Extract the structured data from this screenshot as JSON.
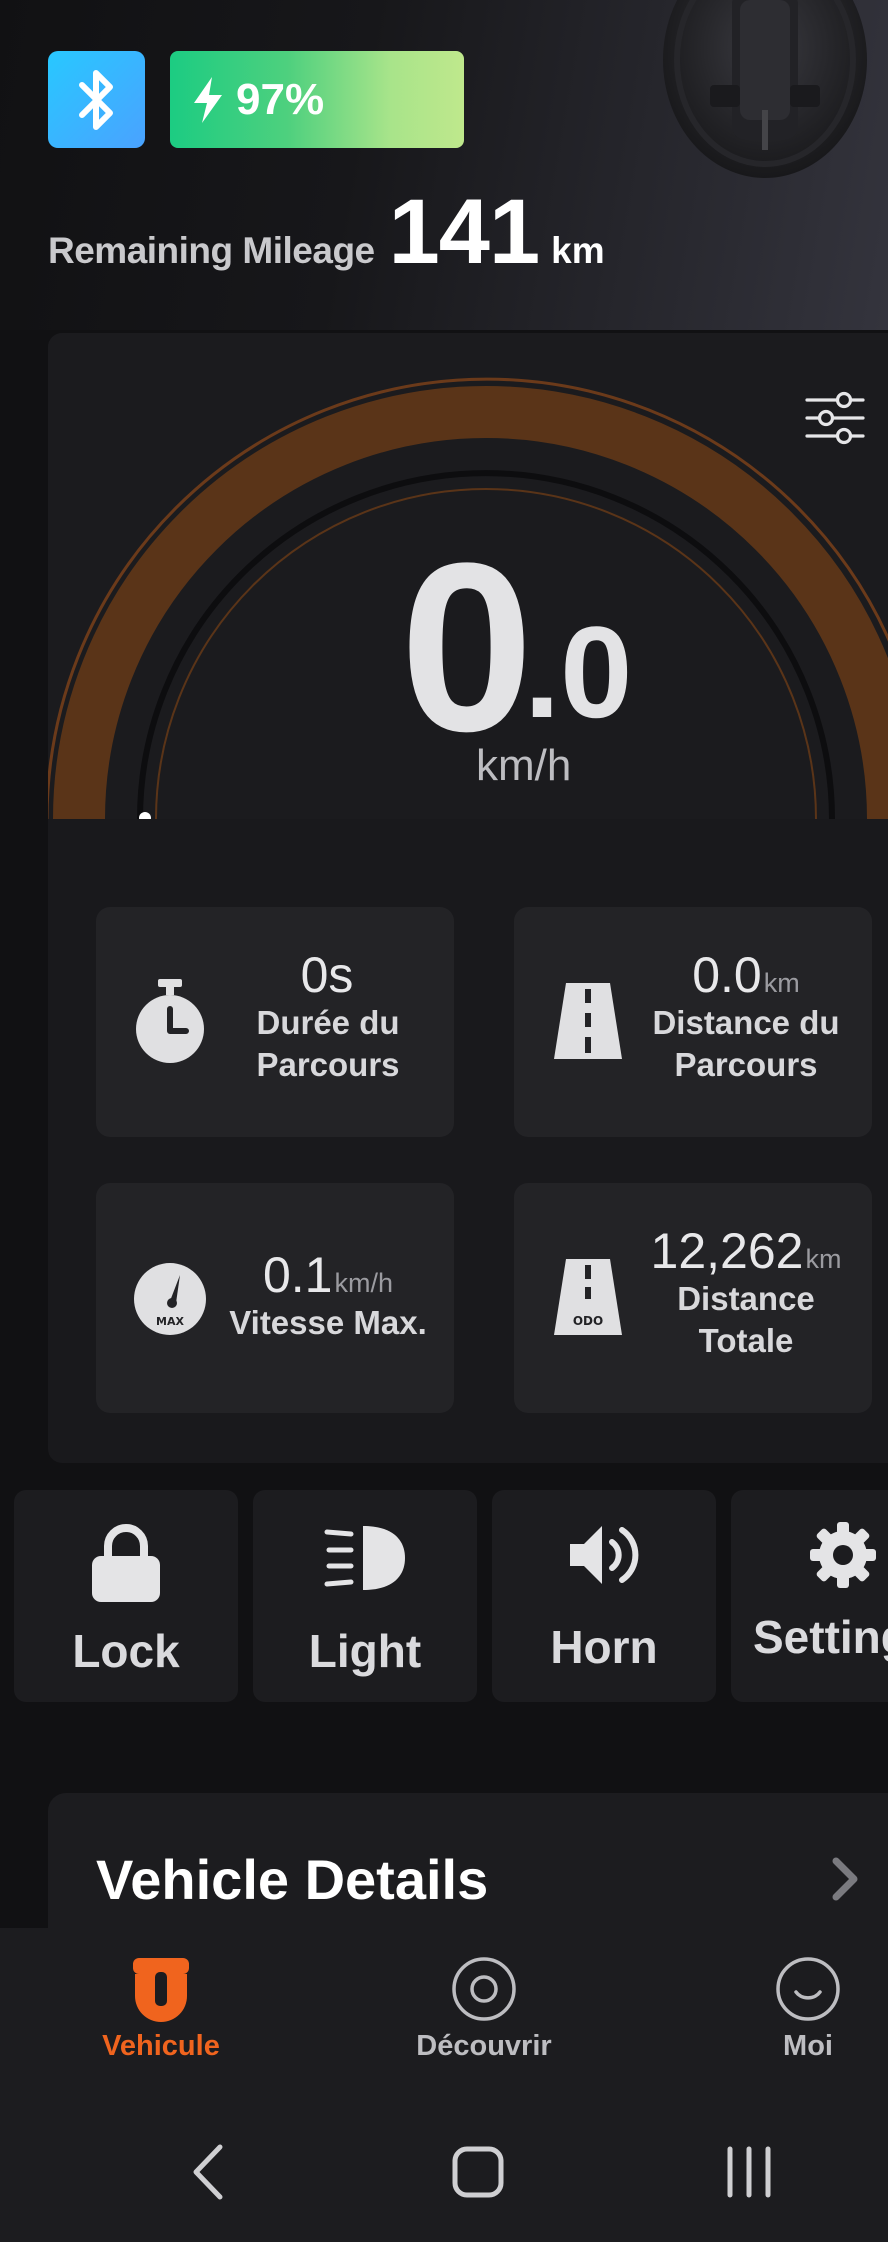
{
  "header": {
    "bluetooth_icon": "bluetooth-icon",
    "battery_percent": "97%",
    "battery_level": 0.97,
    "mileage_label": "Remaining Mileage",
    "mileage_value": "141",
    "mileage_unit": "km"
  },
  "speedometer": {
    "speed_integer": "0",
    "speed_decimal": ".0",
    "speed_unit": "km/h",
    "speed_value": 0.0,
    "settings_icon": "sliders-icon"
  },
  "stats": [
    {
      "icon": "stopwatch-icon",
      "value": "0s",
      "unit": "",
      "label_line1": "Durée du",
      "label_line2": "Parcours"
    },
    {
      "icon": "road-icon",
      "value": "0.0",
      "unit": "km",
      "label_line1": "Distance du",
      "label_line2": "Parcours"
    },
    {
      "icon": "max-gauge-icon",
      "value": "0.1",
      "unit": "km/h",
      "label_line1": "Vitesse Max.",
      "label_line2": ""
    },
    {
      "icon": "odometer-road-icon",
      "value": "12,262",
      "unit": "km",
      "label_line1": "Distance",
      "label_line2": "Totale"
    }
  ],
  "stat_icon_labels": {
    "max": "MAX",
    "odo": "ODO"
  },
  "actions": [
    {
      "label": "Lock",
      "icon": "lock-icon"
    },
    {
      "label": "Light",
      "icon": "headlight-icon"
    },
    {
      "label": "Horn",
      "icon": "speaker-icon"
    },
    {
      "label": "Setting",
      "icon": "gear-icon"
    }
  ],
  "details": {
    "title": "Vehicle Details",
    "chevron": "chevron-right-icon"
  },
  "bottom_nav": [
    {
      "label": "Vehicule",
      "icon": "vehicle-icon",
      "active": true
    },
    {
      "label": "Découvrir",
      "icon": "discover-icon",
      "active": false
    },
    {
      "label": "Moi",
      "icon": "profile-smile-icon",
      "active": false
    }
  ],
  "colors": {
    "accent_orange": "#f0641e",
    "gauge_arc": "#5a3418",
    "gauge_outline": "#6b3a1a",
    "battery_start": "#1ccc82",
    "battery_end": "#bfe88c",
    "bluetooth_start": "#28c8ff",
    "bluetooth_end": "#4aa2ff"
  }
}
